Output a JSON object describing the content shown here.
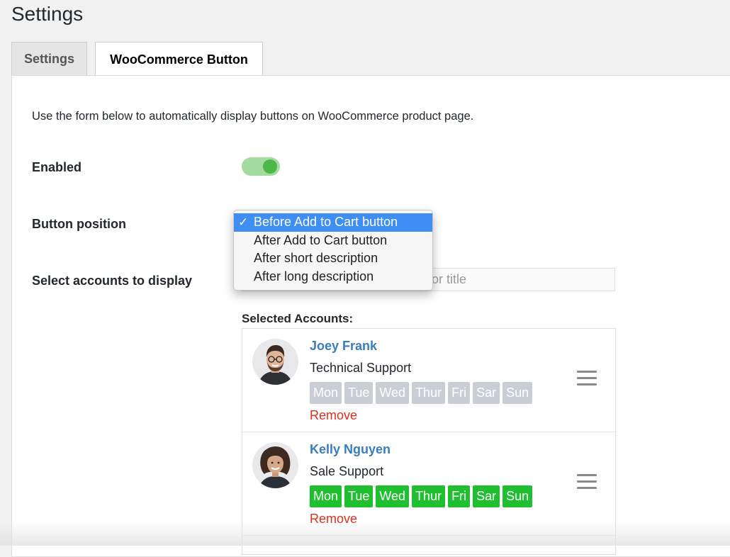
{
  "page_title": "Settings",
  "tabs": [
    {
      "label": "Settings",
      "active": false
    },
    {
      "label": "WooCommerce Button",
      "active": true
    }
  ],
  "intro_text": "Use the form below to automatically display buttons on WooCommerce product page.",
  "enabled": {
    "label": "Enabled",
    "value": true,
    "on_color": "#4cb84a"
  },
  "button_position": {
    "label": "Button position",
    "selected": "Before Add to Cart button",
    "options": [
      "Before Add to Cart button",
      "After Add to Cart button",
      "After short description",
      "After long description"
    ]
  },
  "select_accounts": {
    "label": "Select accounts to display",
    "placeholder_visible": "e or title"
  },
  "selected_accounts": {
    "title": "Selected Accounts:",
    "items": [
      {
        "name": "Joey Frank",
        "role": "Technical Support",
        "days": [
          {
            "label": "Mon",
            "active": false
          },
          {
            "label": "Tue",
            "active": false
          },
          {
            "label": "Wed",
            "active": false
          },
          {
            "label": "Thur",
            "active": false
          },
          {
            "label": "Fri",
            "active": false
          },
          {
            "label": "Sar",
            "active": false
          },
          {
            "label": "Sun",
            "active": false
          }
        ],
        "remove_label": "Remove"
      },
      {
        "name": "Kelly Nguyen",
        "role": "Sale Support",
        "days": [
          {
            "label": "Mon",
            "active": true
          },
          {
            "label": "Tue",
            "active": true
          },
          {
            "label": "Wed",
            "active": true
          },
          {
            "label": "Thur",
            "active": true
          },
          {
            "label": "Fri",
            "active": true
          },
          {
            "label": "Sar",
            "active": true
          },
          {
            "label": "Sun",
            "active": true
          }
        ],
        "remove_label": "Remove"
      }
    ]
  },
  "colors": {
    "link": "#3a7cbf",
    "remove": "#e02e1c",
    "day_on": "#1fbf2f",
    "day_off": "#c9ced6",
    "dropdown_highlight": "#3f8ef3"
  }
}
